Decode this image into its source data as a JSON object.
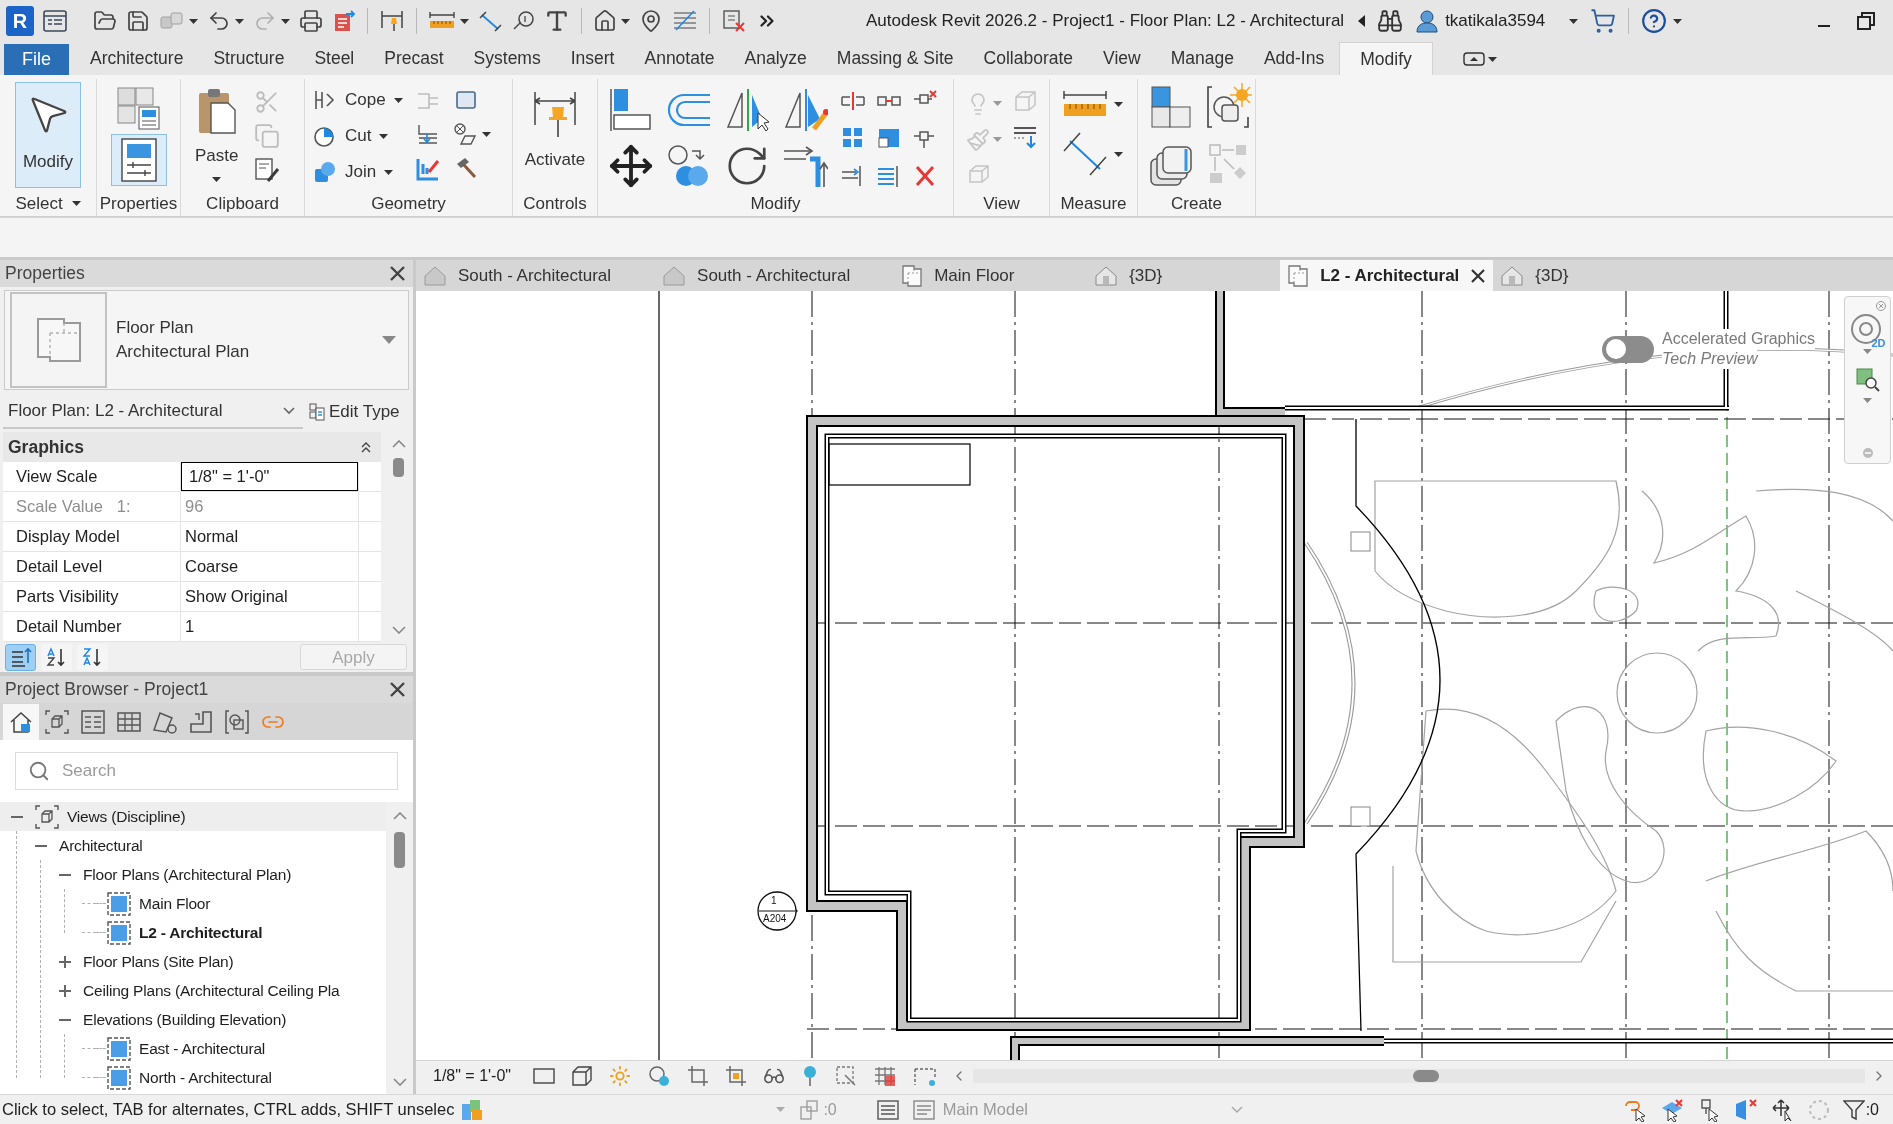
{
  "window": {
    "app_letter": "R",
    "title": "Autodesk Revit 2026.2 - Project1 - Floor Plan: L2 - Architectural",
    "user": "tkatikala3594"
  },
  "ribbon": {
    "tabs": [
      {
        "label": "File",
        "kind": "file",
        "selected": false
      },
      {
        "label": "Architecture",
        "kind": "tab",
        "selected": false
      },
      {
        "label": "Structure",
        "kind": "tab",
        "selected": false
      },
      {
        "label": "Steel",
        "kind": "tab",
        "selected": false
      },
      {
        "label": "Precast",
        "kind": "tab",
        "selected": false
      },
      {
        "label": "Systems",
        "kind": "tab",
        "selected": false
      },
      {
        "label": "Insert",
        "kind": "tab",
        "selected": false
      },
      {
        "label": "Annotate",
        "kind": "tab",
        "selected": false
      },
      {
        "label": "Analyze",
        "kind": "tab",
        "selected": false
      },
      {
        "label": "Massing & Site",
        "kind": "tab",
        "selected": false
      },
      {
        "label": "Collaborate",
        "kind": "tab",
        "selected": false
      },
      {
        "label": "View",
        "kind": "tab",
        "selected": false
      },
      {
        "label": "Manage",
        "kind": "tab",
        "selected": false
      },
      {
        "label": "Add-Ins",
        "kind": "tab",
        "selected": false
      },
      {
        "label": "Modify",
        "kind": "tab",
        "selected": true
      }
    ],
    "panels": [
      {
        "label": "Select",
        "menu": true
      },
      {
        "label": "Properties",
        "menu": false
      },
      {
        "label": "Clipboard",
        "menu": false
      },
      {
        "label": "Geometry",
        "menu": false
      },
      {
        "label": "Controls",
        "menu": false
      },
      {
        "label": "Modify",
        "menu": false
      },
      {
        "label": "View",
        "menu": false
      },
      {
        "label": "Measure",
        "menu": false
      },
      {
        "label": "Create",
        "menu": false
      }
    ],
    "modify_button": {
      "label": "Modify",
      "selected": true
    },
    "properties_button": {
      "selected": true
    },
    "paste_button": {
      "label": "Paste"
    },
    "clipboard_tools": [
      {
        "disabled": true
      },
      {
        "disabled": true
      },
      {
        "disabled": false
      }
    ],
    "geometry_tools": [
      {
        "label": "Cope"
      },
      {
        "label": "Cut"
      },
      {
        "label": "Join"
      }
    ],
    "activate_button": {
      "label": "Activate"
    }
  },
  "properties": {
    "title": "Properties",
    "type_selector": {
      "family": "Floor Plan",
      "type": "Architectural Plan"
    },
    "instance": "Floor Plan: L2 - Architectural",
    "edit_type": "Edit Type",
    "group": {
      "label": "Graphics",
      "expanded": true
    },
    "rows": [
      {
        "label": "View Scale",
        "value": "1/8\" = 1'-0\"",
        "kind": "field",
        "disabled": false
      },
      {
        "label": "Scale Value",
        "unit": "1:",
        "value": "96",
        "kind": "text",
        "disabled": true
      },
      {
        "label": "Display Model",
        "value": "Normal",
        "kind": "text",
        "disabled": false
      },
      {
        "label": "Detail Level",
        "value": "Coarse",
        "kind": "text",
        "disabled": false
      },
      {
        "label": "Parts Visibility",
        "value": "Show Original",
        "kind": "text",
        "disabled": false
      },
      {
        "label": "Detail Number",
        "value": "1",
        "kind": "text",
        "disabled": false
      }
    ],
    "sort_buttons": [
      {
        "selected": true
      },
      {
        "selected": false
      },
      {
        "selected": false
      }
    ],
    "apply": {
      "label": "Apply",
      "disabled": true
    }
  },
  "project_browser": {
    "title": "Project Browser - Project1",
    "toolbar": [
      {
        "selected": true
      },
      {
        "selected": false
      },
      {
        "selected": false
      },
      {
        "selected": false
      },
      {
        "selected": false
      },
      {
        "selected": false
      },
      {
        "selected": false
      },
      {
        "selected": false
      }
    ],
    "search": {
      "placeholder": "Search"
    },
    "tree": [
      {
        "label": "Views (Discipline)",
        "kind": "root",
        "expanded": true,
        "children": [
          {
            "label": "Architectural",
            "kind": "group",
            "expanded": true,
            "children": [
              {
                "label": "Floor Plans (Architectural Plan)",
                "kind": "group",
                "expanded": true,
                "children": [
                  {
                    "label": "Main Floor",
                    "kind": "view",
                    "selected": false
                  },
                  {
                    "label": "L2 - Architectural",
                    "kind": "view",
                    "selected": true
                  }
                ]
              },
              {
                "label": "Floor Plans (Site Plan)",
                "kind": "group",
                "expanded": false
              },
              {
                "label": "Ceiling Plans (Architectural Ceiling Pla",
                "kind": "group",
                "expanded": false
              },
              {
                "label": "Elevations (Building Elevation)",
                "kind": "group",
                "expanded": true,
                "children": [
                  {
                    "label": "East - Architectural",
                    "kind": "view",
                    "selected": false
                  },
                  {
                    "label": "North - Architectural",
                    "kind": "view",
                    "selected": false
                  }
                ]
              }
            ]
          }
        ]
      }
    ]
  },
  "view_tabs": [
    {
      "label": "South - Architectural",
      "kind": "elevation",
      "selected": false
    },
    {
      "label": "South - Architectural",
      "kind": "elevation",
      "selected": false
    },
    {
      "label": "Main Floor",
      "kind": "plan",
      "selected": false
    },
    {
      "label": "{3D}",
      "kind": "model",
      "selected": false
    },
    {
      "label": "L2 - Architectural",
      "kind": "plan",
      "selected": true
    },
    {
      "label": "{3D}",
      "kind": "model",
      "selected": false
    }
  ],
  "canvas": {
    "graphics_toggle": {
      "label": "Accelerated Graphics",
      "note": "Tech Preview",
      "on": false
    },
    "nav_wheel_label": "2D",
    "section_marker": {
      "number": "1",
      "sheet": "A204"
    }
  },
  "view_control_bar": {
    "scale": "1/8\" = 1'-0\""
  },
  "status_bar": {
    "hint": "Click to select, TAB for alternates, CTRL adds, SHIFT unselec",
    "counter": ":0",
    "workset": {
      "label": "Main Model",
      "disabled": true
    },
    "filter_count": ":0"
  }
}
